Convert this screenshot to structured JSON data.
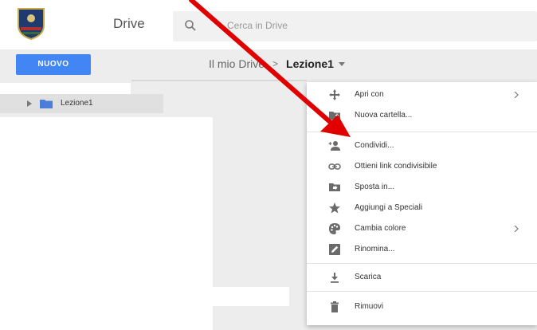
{
  "header": {
    "app_title": "Drive",
    "search_placeholder": "Cerca in Drive"
  },
  "sidebar": {
    "new_button_label": "NUOVO",
    "tree_items": [
      {
        "label": "Lezione1"
      }
    ]
  },
  "breadcrumb": {
    "root": "Il mio Drive",
    "separator": ">",
    "current": "Lezione1"
  },
  "context_menu": {
    "items": [
      {
        "label": "Apri con",
        "icon": "move-arrows-icon",
        "submenu": true
      },
      {
        "label": "Nuova cartella...",
        "icon": "new-folder-icon",
        "submenu": false
      },
      {
        "label": "Condividi...",
        "icon": "share-person-icon",
        "submenu": false
      },
      {
        "label": "Ottieni link condivisibile",
        "icon": "link-icon",
        "submenu": false
      },
      {
        "label": "Sposta in...",
        "icon": "move-to-folder-icon",
        "submenu": false
      },
      {
        "label": "Aggiungi a Speciali",
        "icon": "star-icon",
        "submenu": false
      },
      {
        "label": "Cambia colore",
        "icon": "palette-icon",
        "submenu": true
      },
      {
        "label": "Rinomina...",
        "icon": "rename-icon",
        "submenu": false
      },
      {
        "label": "Scarica",
        "icon": "download-icon",
        "submenu": false
      },
      {
        "label": "Rimuovi",
        "icon": "trash-icon",
        "submenu": false
      }
    ]
  },
  "colors": {
    "accent": "#4285f4",
    "folder": "#4a7ed9",
    "annotation_arrow": "#e00000"
  }
}
